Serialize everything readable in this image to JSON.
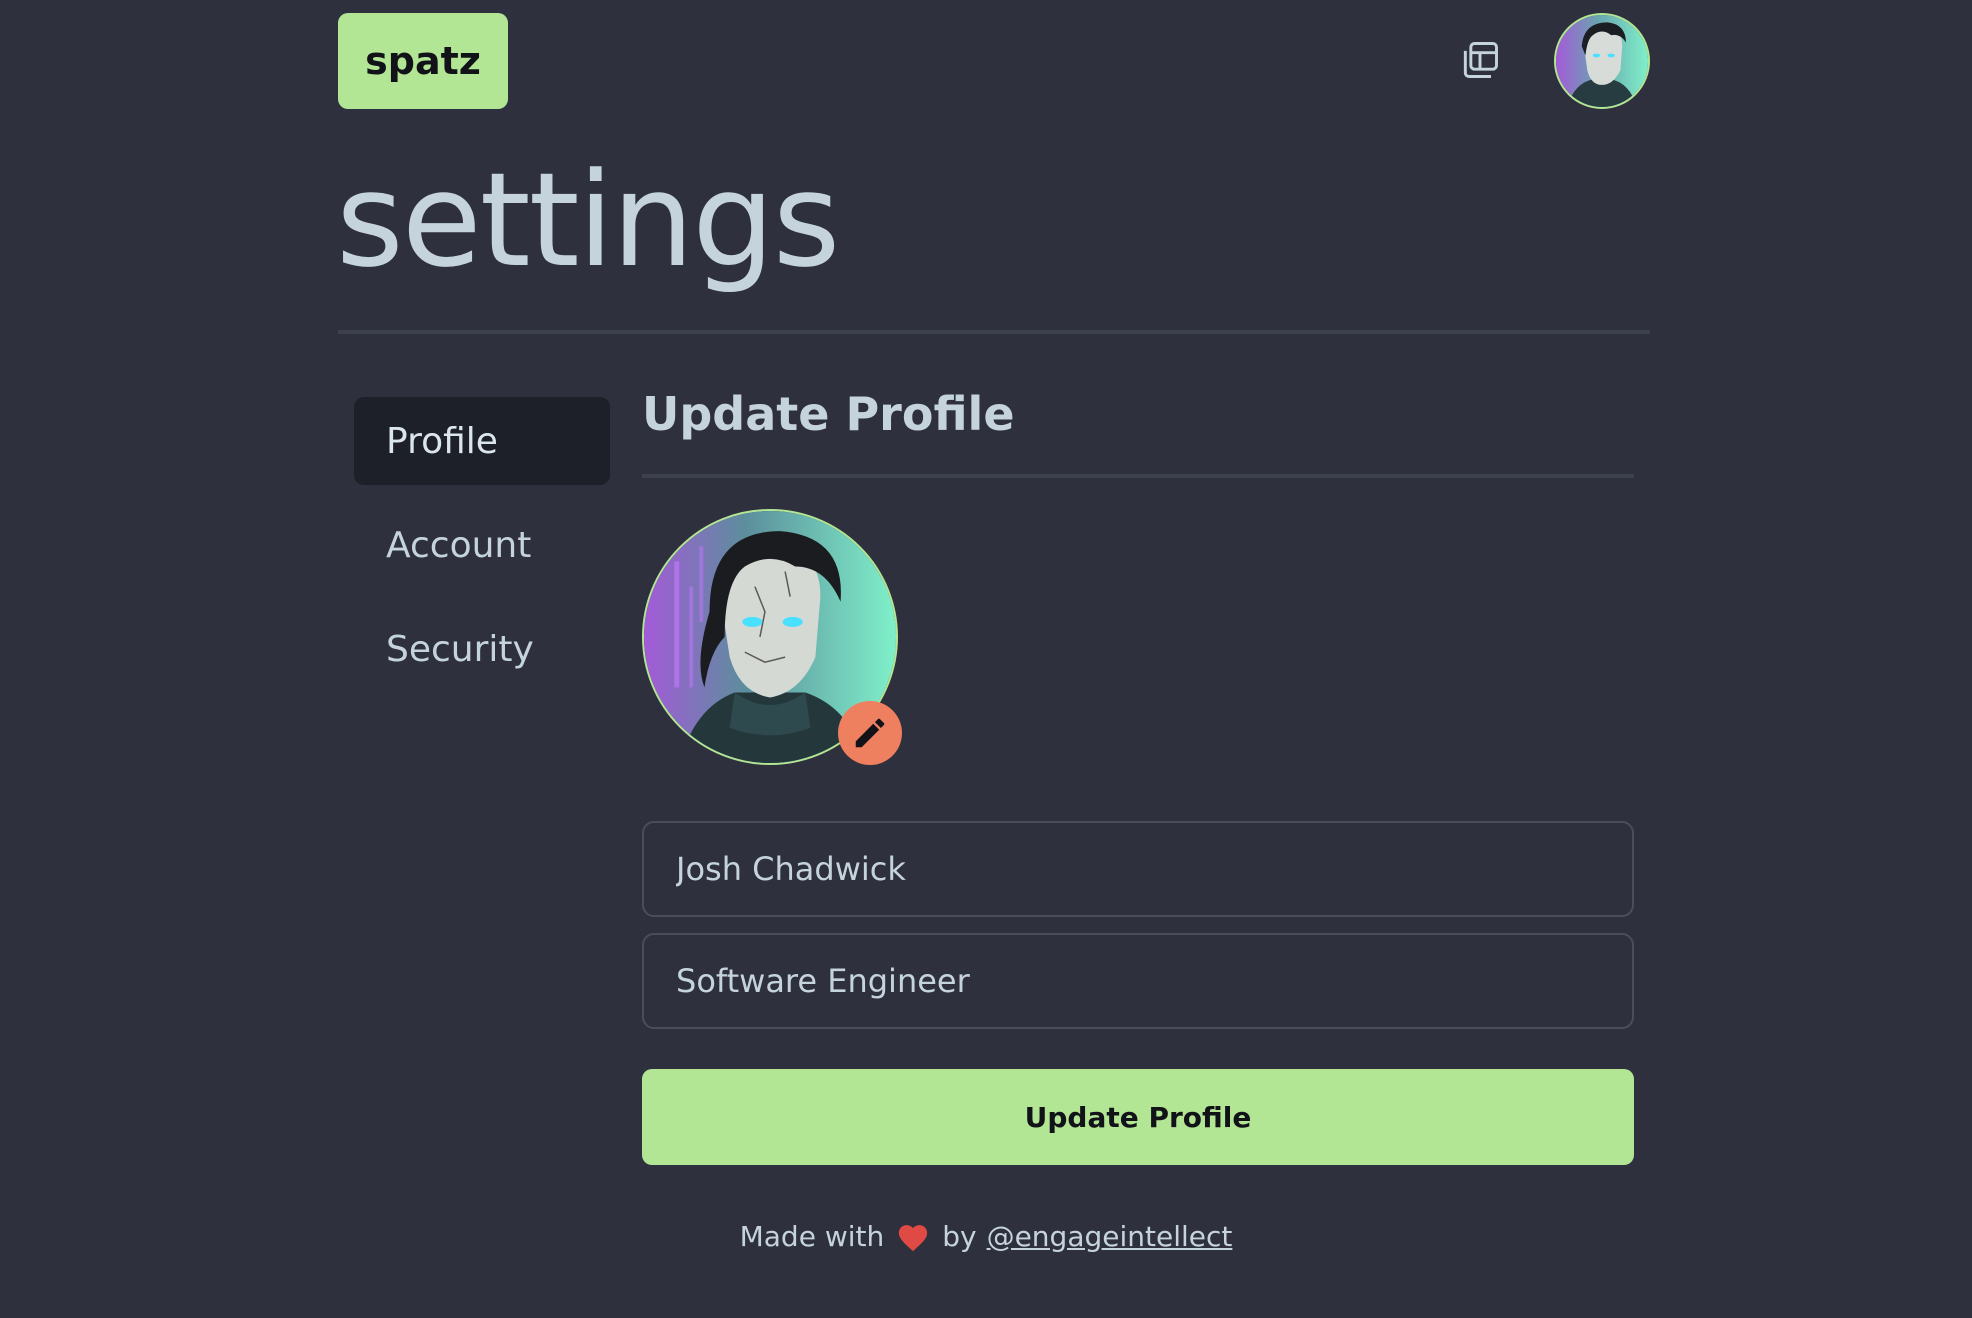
{
  "header": {
    "logo_text": "spatz",
    "windows_icon": "windows-icon",
    "avatar_icon": "user-avatar"
  },
  "page": {
    "title": "settings"
  },
  "sidebar": {
    "items": [
      {
        "label": "Profile",
        "active": true
      },
      {
        "label": "Account",
        "active": false
      },
      {
        "label": "Security",
        "active": false
      }
    ]
  },
  "profile": {
    "section_title": "Update Profile",
    "edit_icon": "pencil-icon",
    "name_value": "Josh Chadwick",
    "job_title_value": "Software Engineer",
    "submit_label": "Update Profile"
  },
  "footer": {
    "made_with": "Made with",
    "heart_icon": "heart-icon",
    "by": "by",
    "link_text": "@engageintellect"
  },
  "colors": {
    "background": "#2e303d",
    "accent": "#b2e594",
    "edit_accent": "#ee7f5f",
    "heart": "#e04a44",
    "text": "#c5d3dc"
  }
}
